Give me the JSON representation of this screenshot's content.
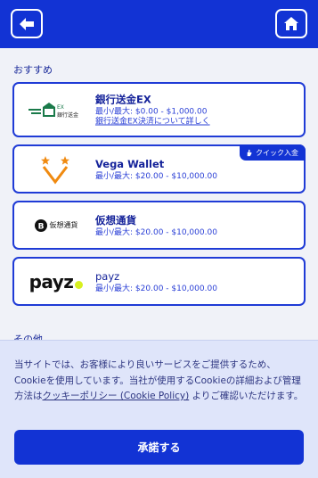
{
  "header": {
    "back_icon": "arrow-left-icon",
    "home_icon": "home-icon"
  },
  "sections": {
    "recommended": "おすすめ",
    "other": "その他"
  },
  "methods": [
    {
      "name": "銀行送金EX",
      "limits": "最小/最大: $0.00 - $1,000.00",
      "link": "銀行送金EX決済について詳しく",
      "logo_text": "銀行送金"
    },
    {
      "name": "Vega Wallet",
      "limits": "最小/最大: $20.00 - $10,000.00",
      "badge": "クイック入金"
    },
    {
      "name": "仮想通貨",
      "limits": "最小/最大: $20.00 - $10,000.00",
      "logo_text": "仮想通貨"
    },
    {
      "name": "payz",
      "limits": "最小/最大: $20.00 - $10,000.00",
      "logo_text": "payz"
    }
  ],
  "cookie": {
    "text_before": "当サイトでは、お客様により良いサービスをご提供するため、Cookieを使用しています。当社が使用するCookieの詳細および管理方法は",
    "policy_link": "クッキーポリシー (Cookie Policy)",
    "text_after": " よりご確認いただけます。",
    "accept_label": "承諾する"
  },
  "colors": {
    "primary": "#1233d4",
    "background": "#f0f2f8",
    "cookie_bg": "#dfe5fa"
  }
}
